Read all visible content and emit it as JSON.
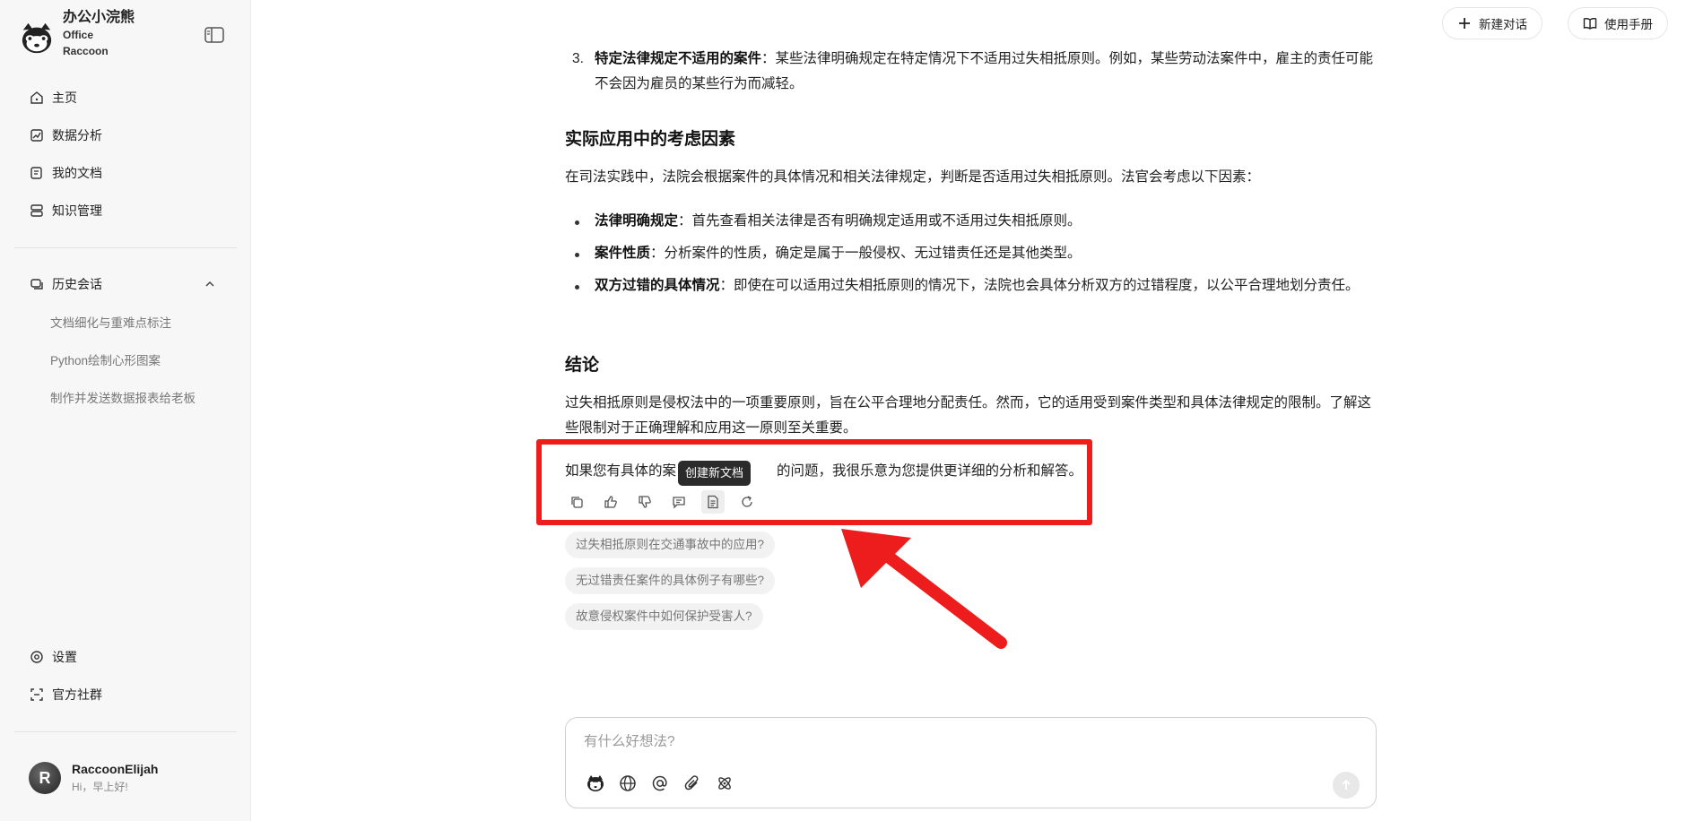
{
  "sidebar": {
    "brand_cn": "办公小浣熊",
    "brand_en_1": "Office",
    "brand_en_2": "Raccoon",
    "nav": [
      {
        "label": "主页",
        "icon": "home-icon"
      },
      {
        "label": "数据分析",
        "icon": "chart-icon"
      },
      {
        "label": "我的文档",
        "icon": "document-icon"
      },
      {
        "label": "知识管理",
        "icon": "knowledge-icon"
      }
    ],
    "history_title": "历史会话",
    "history": [
      "文档细化与重难点标注",
      "Python绘制心形图案",
      "制作并发送数据报表给老板"
    ],
    "bottom": [
      {
        "label": "设置",
        "icon": "gear-icon"
      },
      {
        "label": "官方社群",
        "icon": "community-icon"
      }
    ],
    "user_initial": "R",
    "user_name": "RaccoonElijah",
    "user_greeting": "Hi，早上好!"
  },
  "topbar": {
    "new_chat": "新建对话",
    "manual": "使用手册"
  },
  "content": {
    "item3_num": "3.",
    "item3_bold": "特定法律规定不适用的案件",
    "item3_text": "：某些法律明确规定在特定情况下不适用过失相抵原则。例如，某些劳动法案件中，雇主的责任可能不会因为雇员的某些行为而减轻。",
    "h_practical": "实际应用中的考虑因素",
    "p_practical": "在司法实践中，法院会根据案件的具体情况和相关法律规定，判断是否适用过失相抵原则。法官会考虑以下因素：",
    "bullets": [
      {
        "bold": "法律明确规定",
        "text": "：首先查看相关法律是否有明确规定适用或不适用过失相抵原则。"
      },
      {
        "bold": "案件性质",
        "text": "：分析案件的性质，确定是属于一般侵权、无过错责任还是其他类型。"
      },
      {
        "bold": "双方过错的具体情况",
        "text": "：即使在可以适用过失相抵原则的情况下，法院也会具体分析双方的过错程度，以公平合理地划分责任。"
      }
    ],
    "h_conclusion": "结论",
    "p_conclusion": "过失相抵原则是侵权法中的一项重要原则，旨在公平合理地分配责任。然而，它的适用受到案件类型和具体法律规定的限制。了解这些限制对于正确理解和应用这一原则至关重要。",
    "p_followup_a": "如果您有具体的案",
    "p_followup_b": "的问题，我很乐意为您提供更详细的分析和解答。",
    "tooltip": "创建新文档"
  },
  "suggestions": [
    "过失相抵原则在交通事故中的应用?",
    "无过错责任案件的具体例子有哪些?",
    "故意侵权案件中如何保护受害人?"
  ],
  "input": {
    "placeholder": "有什么好想法?",
    "value": ""
  },
  "colors": {
    "highlight": "#ee1d1d",
    "sidebar_bg": "#f7f7f8"
  }
}
